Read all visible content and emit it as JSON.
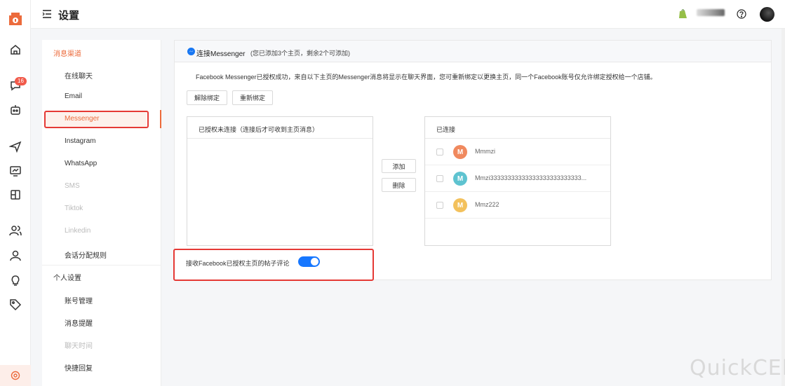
{
  "header": {
    "title": "设置"
  },
  "rail": {
    "unread_badge": "16"
  },
  "side_menu": {
    "section_channels": "消息渠道",
    "channel_items": [
      {
        "label": "在线聊天",
        "state": "normal"
      },
      {
        "label": "Email",
        "state": "normal"
      },
      {
        "label": "Messenger",
        "state": "active"
      },
      {
        "label": "Instagram",
        "state": "normal"
      },
      {
        "label": "WhatsApp",
        "state": "normal"
      },
      {
        "label": "SMS",
        "state": "disabled"
      },
      {
        "label": "Tiktok",
        "state": "disabled"
      },
      {
        "label": "Linkedin",
        "state": "disabled"
      },
      {
        "label": "会话分配规则",
        "state": "normal"
      }
    ],
    "section_personal": "个人设置",
    "personal_items": [
      {
        "label": "账号管理",
        "state": "normal"
      },
      {
        "label": "消息提醒",
        "state": "normal"
      },
      {
        "label": "聊天时间",
        "state": "disabled"
      },
      {
        "label": "快捷回复",
        "state": "normal"
      }
    ]
  },
  "panel": {
    "title": "连接Messenger",
    "subtitle": "(您已添加3个主页，剩余2个可添加)",
    "description": "Facebook Messenger已授权成功，来自以下主页的Messenger消息将显示在聊天界面，您可重新绑定以更换主页，同一个Facebook账号仅允许绑定授权给一个店铺。",
    "unbind_button": "解除绑定",
    "rebind_button": "重新绑定",
    "unconnected_title": "已授权未连接（连接后才可收到主页消息）",
    "add_button": "添加",
    "remove_button": "删除",
    "connected_title": "已连接",
    "connected_pages": [
      {
        "initial": "M",
        "name": "Mmmzi",
        "color": "#f0895e"
      },
      {
        "initial": "M",
        "name": "Mmzi33333333333333333333333333...",
        "color": "#5ec3d0"
      },
      {
        "initial": "M",
        "name": "Mmz222",
        "color": "#f3c15c"
      }
    ],
    "toggle_label": "接收Facebook已授权主页的帖子评论",
    "toggle_on": true
  },
  "watermark": "QuickCEP",
  "colors": {
    "accent": "#ec6b3c",
    "switch": "#1677ff",
    "highlight": "#e53935"
  }
}
